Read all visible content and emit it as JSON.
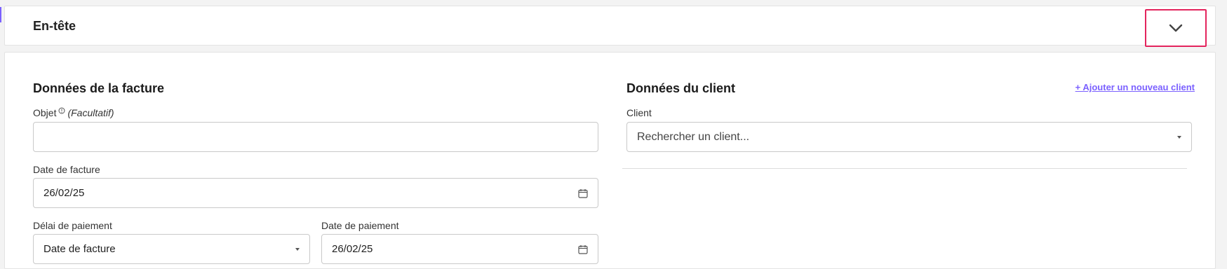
{
  "header": {
    "title": "En-tête"
  },
  "invoice": {
    "title": "Données de la facture",
    "objet_label": "Objet",
    "objet_optional": "(Facultatif)",
    "objet_value": "",
    "date_label": "Date de facture",
    "date_value": "26/02/25",
    "delai_label": "Délai de paiement",
    "delai_value": "Date de facture",
    "date_paiement_label": "Date de paiement",
    "date_paiement_value": "26/02/25"
  },
  "client": {
    "title": "Données du client",
    "add_link": "+ Ajouter un nouveau client",
    "client_label": "Client",
    "search_placeholder": "Rechercher un client..."
  },
  "colors": {
    "accent": "#7b61ff",
    "highlight": "#e3245d"
  }
}
